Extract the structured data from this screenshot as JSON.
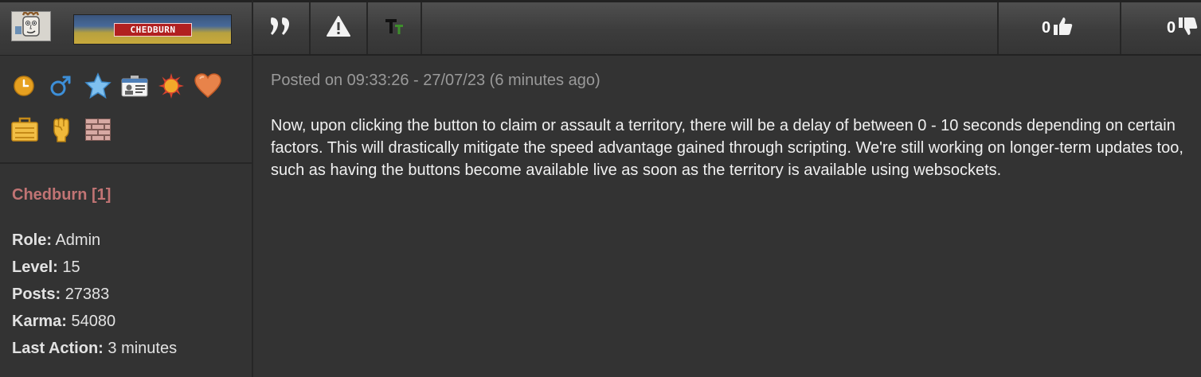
{
  "user": {
    "banner_text": "CHEDBURN",
    "name": "Chedburn [1]",
    "stats": [
      {
        "label": "Role:",
        "value": "Admin"
      },
      {
        "label": "Level:",
        "value": "15"
      },
      {
        "label": "Posts:",
        "value": "27383"
      },
      {
        "label": "Karma:",
        "value": "54080"
      },
      {
        "label": "Last Action:",
        "value": "3 minutes"
      }
    ],
    "icons": [
      "clock-icon",
      "male-icon",
      "star-icon",
      "id-card-icon",
      "sun-icon",
      "heart-icon",
      "briefcase-icon",
      "fist-icon",
      "brick-wall-icon"
    ]
  },
  "toolbar": {
    "quote_icon": "quote-icon",
    "report_icon": "warning-icon",
    "translate_icon": "text-tt-icon",
    "likes": "0",
    "dislikes": "0"
  },
  "post": {
    "posted": "Posted on 09:33:26 - 27/07/23 (6 minutes ago)",
    "body": "Now, upon clicking the button to claim or assault a territory, there will be a delay of between 0 - 10 seconds depending on certain factors. This will drastically mitigate the speed advantage gained through scripting. We're still working on longer-term updates too, such as having the buttons become available live as soon as the territory is available using websockets."
  },
  "colors": {
    "background": "#333333",
    "username": "#c17474",
    "posted_text": "#9a9a9a",
    "body_text": "#f0f0f0"
  }
}
